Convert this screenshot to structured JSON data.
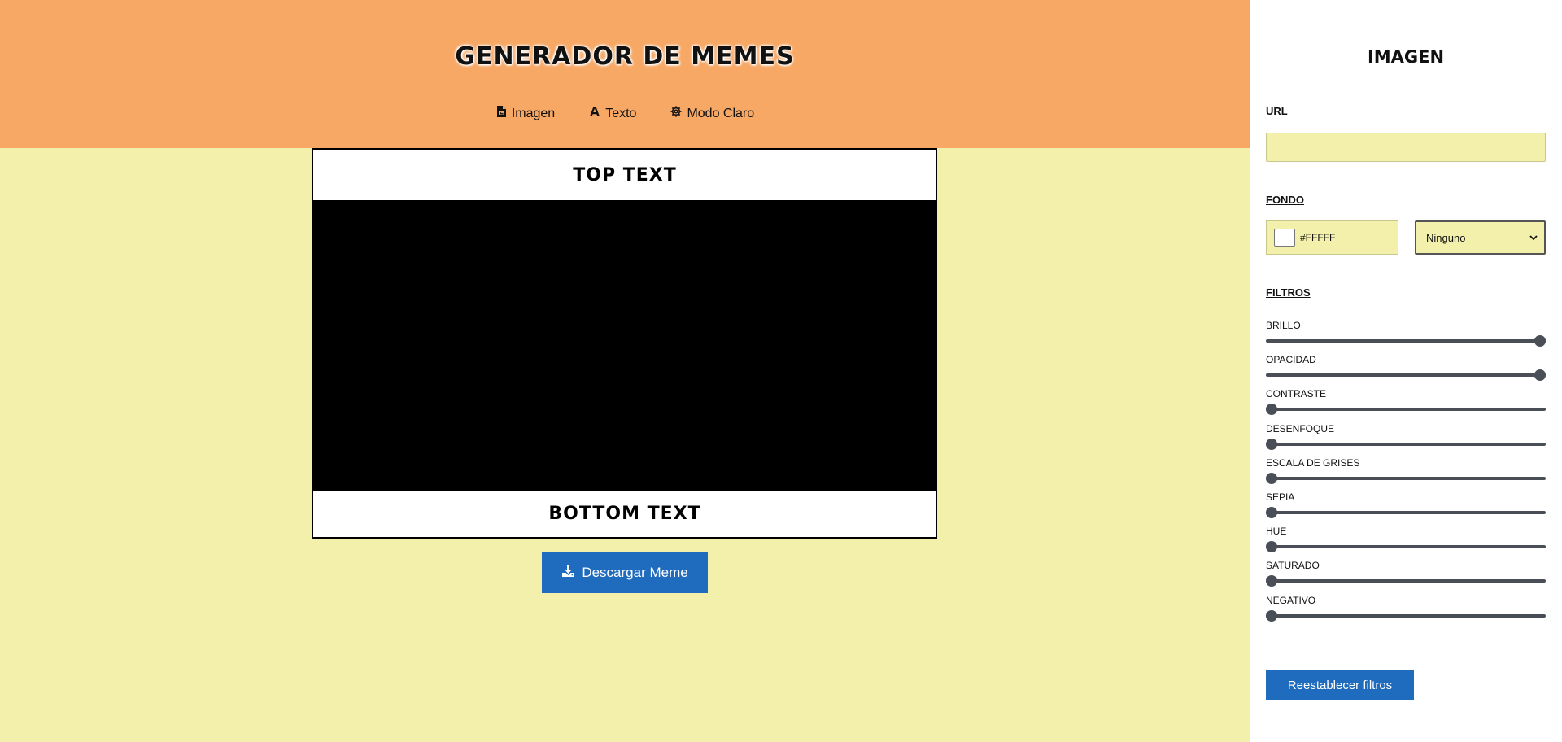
{
  "header": {
    "title": "GENERADOR DE MEMES",
    "nav": [
      {
        "label": "Imagen",
        "icon": "image-file-icon"
      },
      {
        "label": "Texto",
        "icon": "font-icon"
      },
      {
        "label": "Modo Claro",
        "icon": "gear-icon"
      }
    ]
  },
  "meme": {
    "top_text": "TOP TEXT",
    "bottom_text": "BOTTOM TEXT",
    "download_label": "Descargar Meme"
  },
  "panel": {
    "title": "IMAGEN",
    "url_label": "URL",
    "url_value": "",
    "fondo_label": "FONDO",
    "color_value": "#FFFFF",
    "blend_selected": "Ninguno",
    "filtros_label": "FILTROS",
    "filters": [
      {
        "label": "BRILLO",
        "value": 1
      },
      {
        "label": "OPACIDAD",
        "value": 1
      },
      {
        "label": "CONTRASTE",
        "value": 0
      },
      {
        "label": "DESENFOQUE",
        "value": 0
      },
      {
        "label": "ESCALA DE GRISES",
        "value": 0
      },
      {
        "label": "SEPIA",
        "value": 0
      },
      {
        "label": "HUE",
        "value": 0
      },
      {
        "label": "SATURADO",
        "value": 0
      },
      {
        "label": "NEGATIVO",
        "value": 0
      }
    ],
    "reset_label": "Reestablecer filtros"
  },
  "colors": {
    "header_bg": "#f7a865",
    "page_bg": "#f2f0ab",
    "accent": "#1f6bbd"
  }
}
